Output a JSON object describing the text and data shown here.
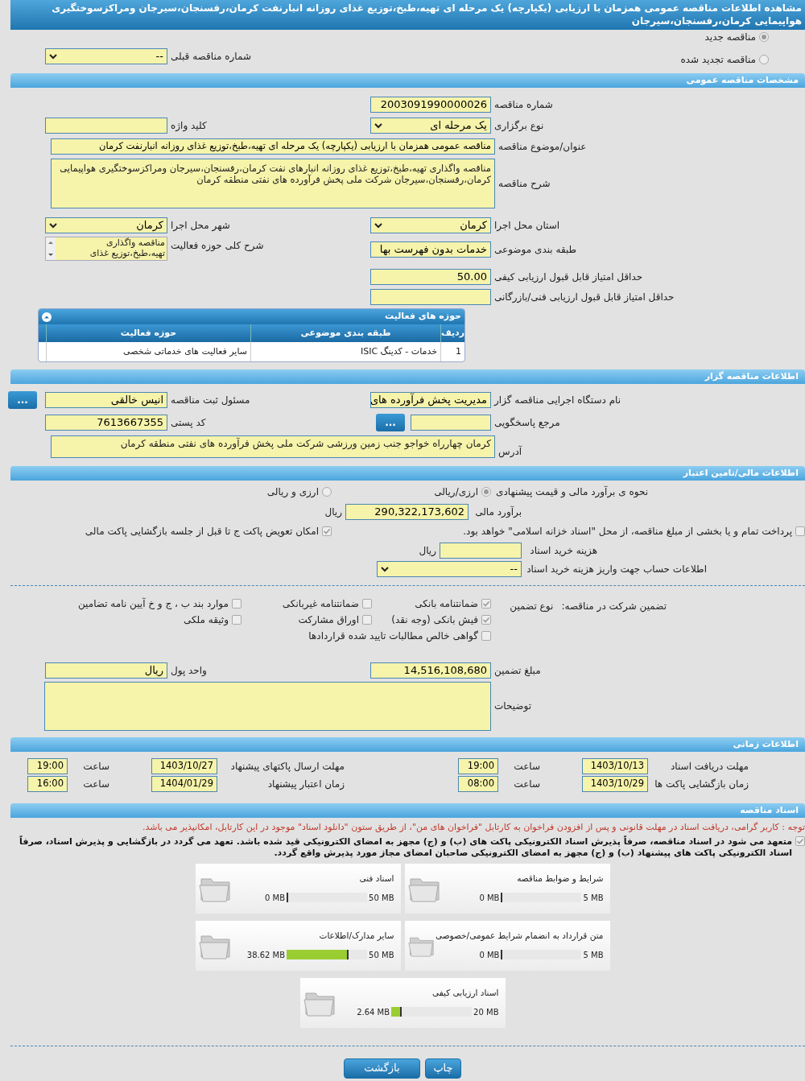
{
  "title": "مشاهده اطلاعات مناقصه عمومی همزمان با ارزیابی (یکپارچه) یک مرحله ای تهیه،طبخ،توزیع غذای روزانه انبارنفت کرمان،رفسنجان،سیرجان ومراکزسوختگیری هواپیمایی کرمان،رفسنجان،سیرجان",
  "tender_kind": [
    {
      "label": "مناقصه جدید",
      "selected": true
    },
    {
      "label": "مناقصه تجدید شده",
      "selected": false
    }
  ],
  "previous_tender": {
    "label": "شماره مناقصه قبلی",
    "value": "--"
  },
  "general": {
    "title": "مشخصات مناقصه عمومی",
    "number": {
      "label": "شماره مناقصه",
      "value": "2003091990000026"
    },
    "holding_type": {
      "label": "نوع برگزاری",
      "value": "یک مرحله ای"
    },
    "keyword": {
      "label": "کلید واژه"
    },
    "subject": {
      "label": "عنوان/موضوع مناقصه",
      "value": "مناقصه عمومی همزمان با ارزیابی (یکپارچه) یک مرحله ای تهیه،طبخ،توزیع غذای روزانه انبارنفت کرمان"
    },
    "description": {
      "label": "شرح مناقصه",
      "value": "مناقصه واگذاری تهیه،طبخ،توزیع غذای روزانه انبارهای نفت کرمان،رفسنجان،سیرجان ومراکزسوختگیری هواپیمایی کرمان،رفسنجان،سیرجان شرکت ملی پخش فرآورده های نفتی منطقه کرمان"
    },
    "province": {
      "label": "استان محل اجرا",
      "value": "کرمان"
    },
    "city": {
      "label": "شهر محل اجرا",
      "value": "کرمان"
    },
    "category": {
      "label": "طبقه بندی موضوعی",
      "value": "خدمات بدون فهرست بها"
    },
    "activity_scope": {
      "label": "شرح کلی حوزه فعالیت",
      "value": "مناقصه واگذاری تهیه،طبخ،توزیع غذای"
    },
    "min_quality_score": {
      "label": "حداقل امتیاز قابل قبول ارزیابی کیفی",
      "value": "50.00"
    },
    "min_technical_score": {
      "label": "حداقل امتیاز قابل قبول ارزیابی فنی/بازرگانی"
    },
    "activities_table": {
      "title": "حوزه های فعالیت",
      "columns": [
        "ردیف",
        "طبقه بندی موضوعی",
        "حوزه فعالیت"
      ],
      "rows": [
        [
          "1",
          "خدمات - کدینگ ISIC",
          "سایر فعالیت های خدماتی شخصی"
        ]
      ]
    }
  },
  "tenderer": {
    "title": "اطلاعات مناقصه گزار",
    "organization": {
      "label": "نام دستگاه اجرایی مناقصه گزار",
      "value": "مدیریت پخش فرآورده های"
    },
    "registrar": {
      "label": "مسئول ثبت مناقصه",
      "value": "انیس  خالقی",
      "button": "..."
    },
    "reference": {
      "label": "مرجع پاسخگویی",
      "button": "..."
    },
    "postal_code": {
      "label": "کد پستی",
      "value": "7613667355"
    },
    "address": {
      "label": "آدرس",
      "value": "کرمان چهارراه خواجو جنب زمین ورزشی شرکت ملی پخش فرآورده های نفتی منطقه کرمان"
    }
  },
  "finance": {
    "title": "اطلاعات مالی/تامین اعتبار",
    "pricing": {
      "label": "نحوه ی برآورد مالی و قیمت پیشنهادی",
      "options": [
        {
          "label": "ارزی/ریالی",
          "selected": true
        },
        {
          "label": "ارزی و ریالی",
          "selected": false
        }
      ]
    },
    "estimate": {
      "label": "برآورد مالی",
      "value": "290,322,173,602",
      "unit": "ریال"
    },
    "treasury": {
      "label": "پرداخت تمام و یا بخشی از مبلغ مناقصه، از محل \"اسناد خزانه اسلامی\" خواهد بود.",
      "checked": false
    },
    "envelope_swap": {
      "label": "امکان تعویض پاکت ج تا قبل از جلسه بازگشایی پاکت مالی",
      "checked": true
    },
    "document_cost": {
      "label": "هزینه خرید اسناد",
      "unit": "ریال"
    },
    "account": {
      "label": "اطلاعات حساب جهت واریز هزینه خرید اسناد",
      "value": "--"
    }
  },
  "guarantee": {
    "label": "تضمین شرکت در مناقصه:",
    "type_label": "نوع تضمین",
    "options": [
      {
        "label": "ضمانتنامه بانکی",
        "checked": true
      },
      {
        "label": "ضمانتنامه غیربانکی",
        "checked": false
      },
      {
        "label": "موارد بند ب ، ج و خ آیین نامه تضامین",
        "checked": false
      },
      {
        "label": "فیش بانکی (وجه نقد)",
        "checked": true
      },
      {
        "label": "اوراق مشارکت",
        "checked": false
      },
      {
        "label": "وثیقه ملکی",
        "checked": false
      },
      {
        "label": "گواهی خالص مطالبات تایید شده قراردادها",
        "checked": false
      }
    ],
    "amount": {
      "label": "مبلغ تضمین",
      "value": "14,516,108,680"
    },
    "currency": {
      "label": "واحد پول",
      "value": "ریال"
    },
    "notes": {
      "label": "توضیحات"
    }
  },
  "timing": {
    "title": "اطلاعات زمانی",
    "rows": [
      {
        "label": "مهلت دریافت اسناد",
        "date": "1403/10/13",
        "time_label": "ساعت",
        "time": "19:00"
      },
      {
        "label": "مهلت ارسال پاکتهای پیشنهاد",
        "date": "1403/10/27",
        "time_label": "ساعت",
        "time": "19:00"
      },
      {
        "label": "زمان بازگشایی پاکت ها",
        "date": "1403/10/29",
        "time_label": "ساعت",
        "time": "08:00"
      },
      {
        "label": "زمان اعتبار پیشنهاد",
        "date": "1404/01/29",
        "time_label": "ساعت",
        "time": "16:00"
      }
    ]
  },
  "documents": {
    "title": "اسناد مناقصه",
    "notice": "توجه : کاربر گرامی، دریافت اسناد در مهلت قانونی و پس از افزودن فراخوان به کارتابل \"فراخوان های من\"، از طریق ستون \"دانلود اسناد\" موجود در این کارتابل، امکانپذیر می باشد.",
    "commitment": {
      "checked": true,
      "text": "متعهد می شود در اسناد مناقصه، صرفاً پذیرش اسناد الکترونیکی پاکت های (ب) و (ج) مجهز به امضای الکترونیکی قید شده باشد. تعهد می گردد در بازگشایی و پذیرش اسناد، صرفاً اسناد الکترونیکی پاکت های پیشنهاد (ب) و (ج) مجهز به امضای الکترونیکی صاحبان امضای مجاز مورد پذیرش واقع گردد."
    },
    "files": [
      {
        "name": "شرایط و ضوابط مناقصه",
        "used": "0 MB",
        "max": "5 MB",
        "level": 0
      },
      {
        "name": "اسناد فنی",
        "used": "0 MB",
        "max": "50 MB",
        "level": 0
      },
      {
        "name": "متن قرارداد به انضمام شرایط عمومی/خصوصی",
        "used": "0 MB",
        "max": "5 MB",
        "level": 0
      },
      {
        "name": "سایر مدارک/اطلاعات",
        "used": "38.62 MB",
        "max": "50 MB",
        "level": 0.77
      },
      {
        "name": "اسناد ارزیابی کیفی",
        "used": "2.64 MB",
        "max": "20 MB",
        "level": 0.13
      }
    ]
  },
  "buttons": [
    {
      "label": "چاپ"
    },
    {
      "label": "بازگشت"
    }
  ]
}
